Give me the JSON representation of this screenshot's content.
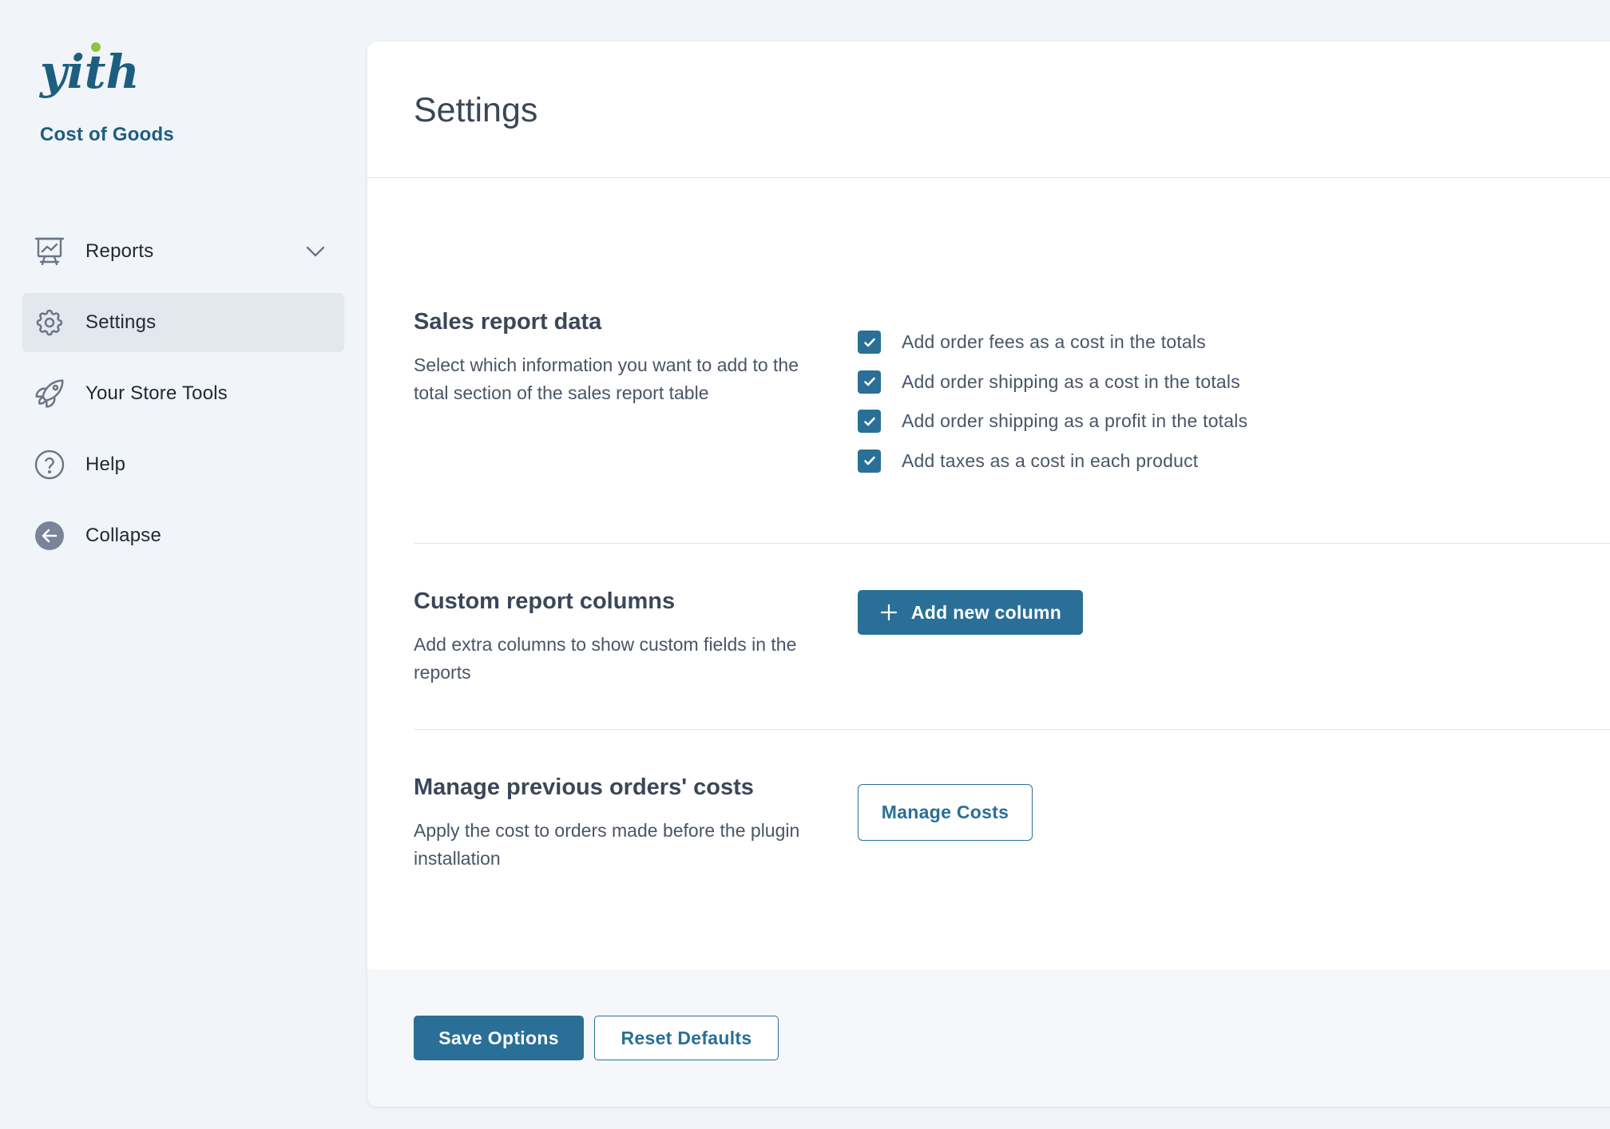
{
  "brand": {
    "logo_text": "yith",
    "subtitle": "Cost of Goods"
  },
  "sidebar": {
    "items": [
      {
        "label": "Reports",
        "icon": "presentation-chart-icon",
        "has_submenu": true
      },
      {
        "label": "Settings",
        "icon": "gear-icon",
        "active": true
      },
      {
        "label": "Your Store Tools",
        "icon": "rocket-icon"
      },
      {
        "label": "Help",
        "icon": "question-circle-icon"
      },
      {
        "label": "Collapse",
        "icon": "arrow-left-circle-icon"
      }
    ]
  },
  "main": {
    "title": "Settings",
    "sections": [
      {
        "title": "Sales report data",
        "description": "Select which information you want to add to the total section of the sales report table",
        "options": [
          {
            "label": "Add order fees as a cost in the totals",
            "checked": true
          },
          {
            "label": "Add order shipping as a cost in the totals",
            "checked": true
          },
          {
            "label": "Add order shipping as a profit in the totals",
            "checked": true
          },
          {
            "label": "Add taxes as a cost in each product",
            "checked": true
          }
        ]
      },
      {
        "title": "Custom report columns",
        "description": "Add extra columns to show custom fields in the reports",
        "button_label": "Add new column",
        "button_icon": "plus-icon"
      },
      {
        "title": "Manage previous orders' costs",
        "description": "Apply the cost to orders made before the plugin installation",
        "button_label": "Manage Costs"
      }
    ]
  },
  "footer": {
    "save_label": "Save Options",
    "reset_label": "Reset Defaults"
  },
  "colors": {
    "brand_blue": "#2a6f97",
    "logo_dark": "#1c5e80",
    "logo_dot": "#8cc63f",
    "background": "#f1f4f8",
    "active_nav": "#e3e8ef"
  }
}
